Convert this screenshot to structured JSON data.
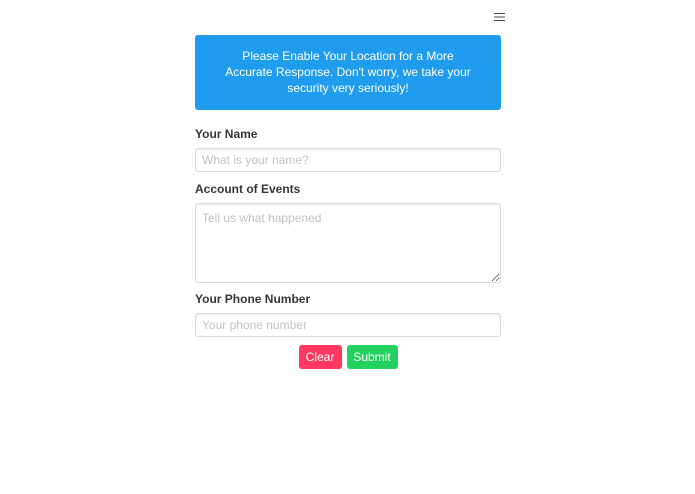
{
  "header": {
    "menu_icon": "hamburger-menu-icon"
  },
  "notice": {
    "text": "Please Enable Your Location for a More Accurate Response. Don't worry, we take your security very seriously!",
    "background_color": "#209cee"
  },
  "form": {
    "name": {
      "label": "Your Name",
      "placeholder": "What is your name?"
    },
    "account": {
      "label": "Account of Events",
      "placeholder": "Tell us what happened"
    },
    "phone": {
      "label": "Your Phone Number",
      "placeholder": "Your phone number"
    },
    "buttons": {
      "clear_label": "Clear",
      "clear_color": "#ff3860",
      "submit_label": "Submit",
      "submit_color": "#23d160"
    }
  }
}
